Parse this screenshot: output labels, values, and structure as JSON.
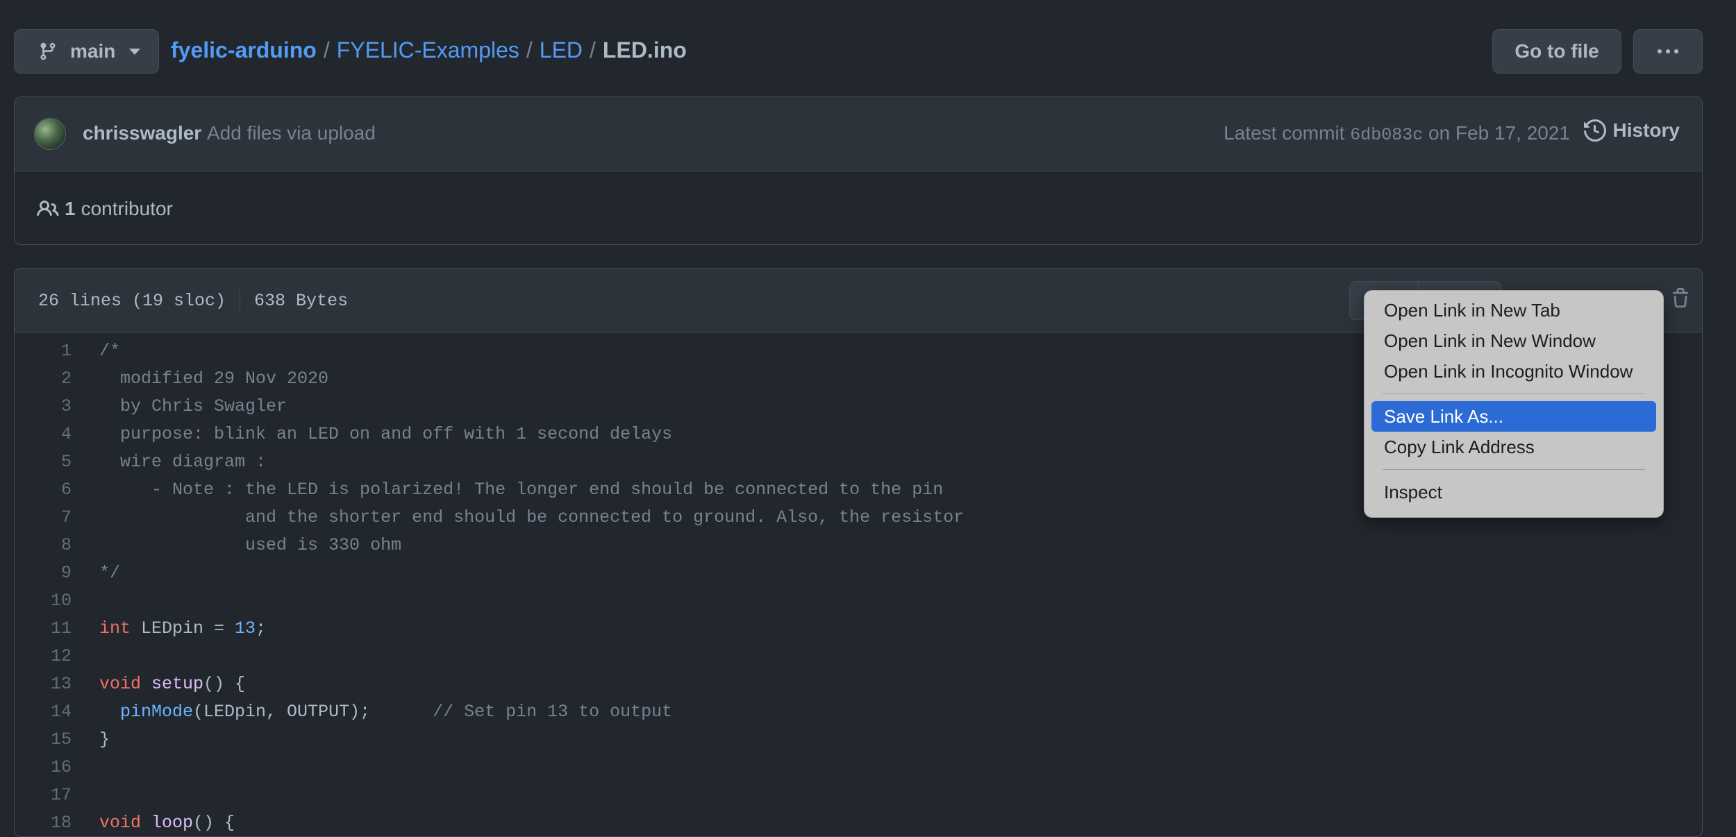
{
  "branch": {
    "label": "main"
  },
  "breadcrumb": {
    "repo": "fyelic-arduino",
    "folder1": "FYELIC-Examples",
    "folder2": "LED",
    "file": "LED.ino",
    "separator": "/"
  },
  "actions": {
    "goto_label": "Go to file",
    "more_icon": "kebab-horizontal-icon"
  },
  "commit": {
    "author": "chrisswagler",
    "message": "Add files via upload",
    "latest_prefix": "Latest commit",
    "sha": "6db083c",
    "date": "on Feb 17, 2021",
    "history_label": "History"
  },
  "contributors": {
    "count": "1",
    "label": "contributor"
  },
  "file": {
    "lines": "26 lines (19 sloc)",
    "size": "638 Bytes"
  },
  "code_lines": [
    {
      "n": "1",
      "text": "/*"
    },
    {
      "n": "2",
      "text": "  modified 29 Nov 2020"
    },
    {
      "n": "3",
      "text": "  by Chris Swagler"
    },
    {
      "n": "4",
      "text": "  purpose: blink an LED on and off with 1 second delays"
    },
    {
      "n": "5",
      "text": "  wire diagram :"
    },
    {
      "n": "6",
      "text": "     - Note : the LED is polarized! The longer end should be connected to the pin"
    },
    {
      "n": "7",
      "text": "              and the shorter end should be connected to ground. Also, the resistor"
    },
    {
      "n": "8",
      "text": "              used is 330 ohm"
    },
    {
      "n": "9",
      "text": "*/"
    },
    {
      "n": "10",
      "text": ""
    },
    {
      "n": "11",
      "kw": "int",
      "rest": " LEDpin = ",
      "num": "13",
      "tail": ";"
    },
    {
      "n": "12",
      "text": ""
    },
    {
      "n": "13",
      "kw": "void",
      "fn": " setup",
      "tail": "() {"
    },
    {
      "n": "14",
      "call": "  pinMode",
      "rest": "(LEDpin, OUTPUT);      ",
      "comment": "// Set pin 13 to output"
    },
    {
      "n": "15",
      "text": "}"
    },
    {
      "n": "16",
      "text": ""
    },
    {
      "n": "17",
      "text": ""
    },
    {
      "n": "18",
      "kw": "void",
      "fn": " loop",
      "tail": "() {"
    }
  ],
  "context_menu": {
    "items": [
      "Open Link in New Tab",
      "Open Link in New Window",
      "Open Link in Incognito Window",
      "Save Link As...",
      "Copy Link Address",
      "Inspect"
    ],
    "highlighted": "Save Link As..."
  },
  "colors": {
    "link": "#539bf5",
    "background": "#22272e",
    "menu_highlight": "#2c6bd6"
  }
}
